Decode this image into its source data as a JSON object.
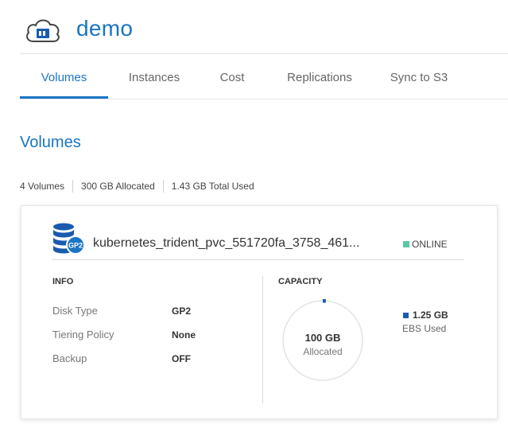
{
  "header": {
    "title": "demo",
    "icon": "cloud-storage-icon"
  },
  "tabs": [
    {
      "label": "Volumes",
      "active": true
    },
    {
      "label": "Instances",
      "active": false
    },
    {
      "label": "Cost",
      "active": false
    },
    {
      "label": "Replications",
      "active": false
    },
    {
      "label": "Sync to S3",
      "active": false
    }
  ],
  "section": {
    "title": "Volumes"
  },
  "summary": {
    "count": "4 Volumes",
    "allocated": "300 GB Allocated",
    "used": "1.43 GB Total Used"
  },
  "volume": {
    "icon": "database-icon",
    "badge": "GP2",
    "name": "kubernetes_trident_pvc_551720fa_3758_461...",
    "status": "ONLINE",
    "info": {
      "heading": "INFO",
      "rows": [
        {
          "label": "Disk Type",
          "value": "GP2"
        },
        {
          "label": "Tiering Policy",
          "value": "None"
        },
        {
          "label": "Backup",
          "value": "OFF"
        }
      ]
    },
    "capacity": {
      "heading": "CAPACITY",
      "total": "100 GB",
      "total_label": "Allocated",
      "used": "1.25 GB",
      "used_label": "EBS Used",
      "used_fraction": 0.0125
    }
  },
  "colors": {
    "accent": "#1a75c4",
    "online": "#57c8a6",
    "ebs": "#1a5bb0"
  }
}
